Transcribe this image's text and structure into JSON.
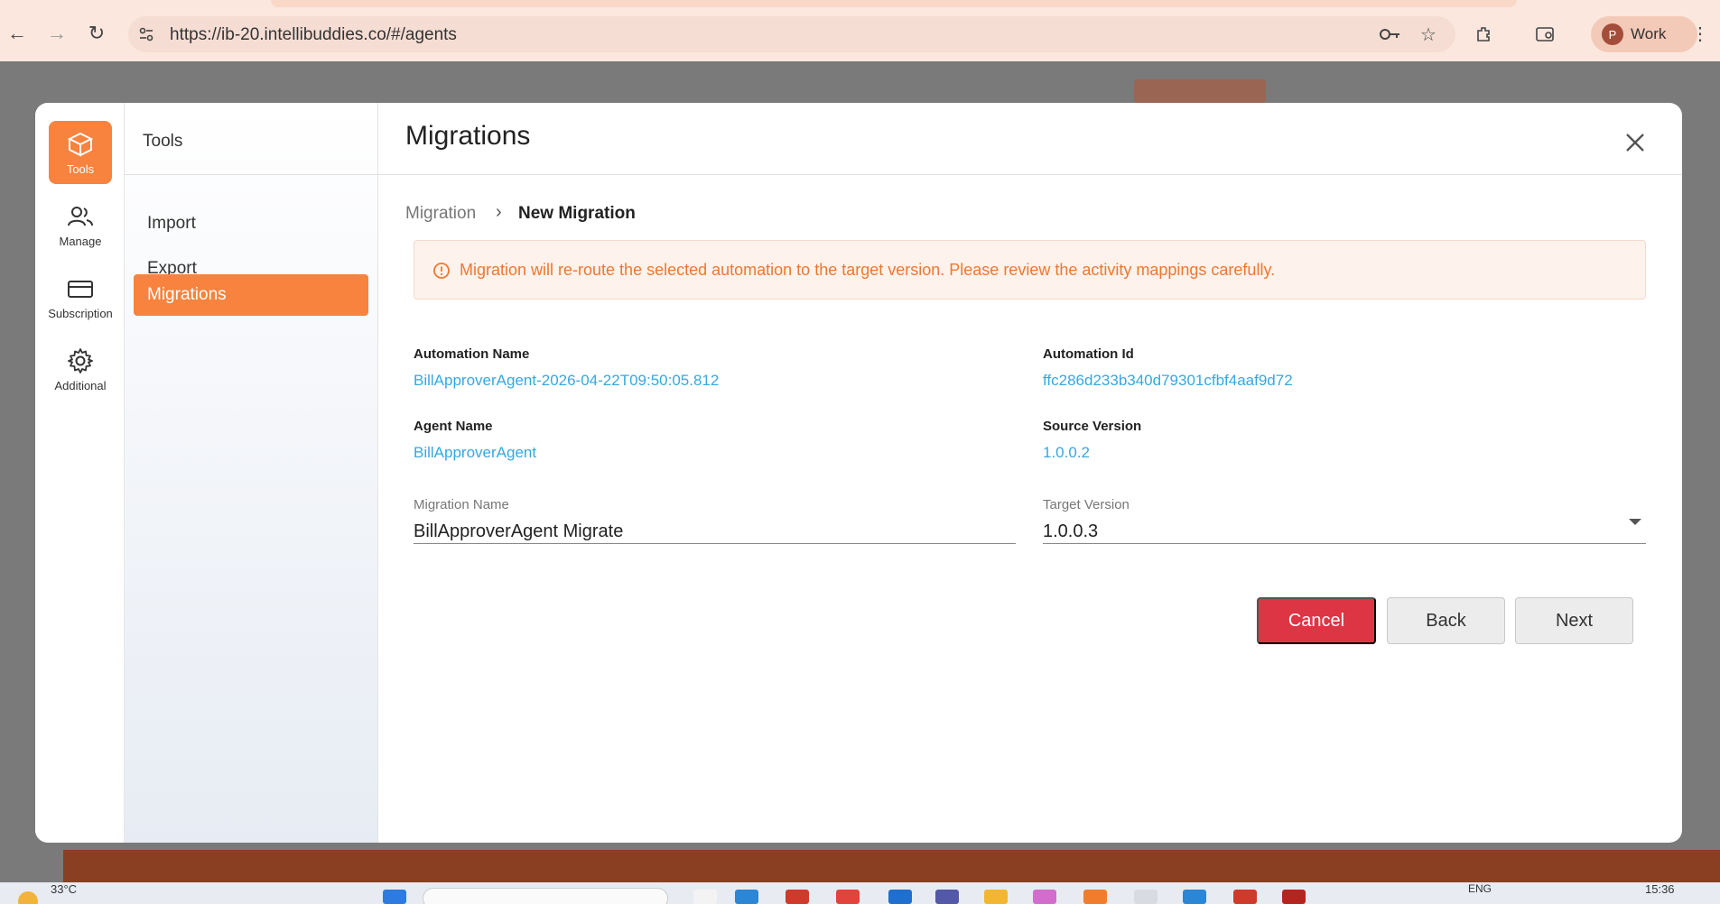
{
  "browser": {
    "url": "https://ib-20.intellibuddies.co/#/agents",
    "profile_initial": "P",
    "profile_label": "Work"
  },
  "rail": {
    "items": [
      {
        "label": "Tools",
        "icon": "box-icon",
        "active": true
      },
      {
        "label": "Manage",
        "icon": "users-icon",
        "active": false
      },
      {
        "label": "Subscription",
        "icon": "card-icon",
        "active": false
      },
      {
        "label": "Additional",
        "icon": "gear-icon",
        "active": false
      }
    ]
  },
  "subnav": {
    "title": "Tools",
    "items": [
      {
        "label": "Import",
        "active": false
      },
      {
        "label": "Export",
        "active": false
      },
      {
        "label": "Migrations",
        "active": true
      }
    ]
  },
  "header": {
    "title": "Migrations"
  },
  "breadcrumb": {
    "parent": "Migration",
    "current": "New Migration"
  },
  "alert": {
    "text": "Migration will re-route the selected automation to the target version. Please review the activity mappings carefully."
  },
  "details": {
    "automation_name_label": "Automation Name",
    "automation_name": "BillApproverAgent-2026-04-22T09:50:05.812",
    "automation_id_label": "Automation Id",
    "automation_id": "ffc286d233b340d79301cfbf4aaf9d72",
    "agent_name_label": "Agent Name",
    "agent_name": "BillApproverAgent",
    "source_version_label": "Source Version",
    "source_version": "1.0.0.2"
  },
  "form": {
    "migration_name_label": "Migration Name",
    "migration_name": "BillApproverAgent Migrate",
    "target_version_label": "Target Version",
    "target_version": "1.0.0.3"
  },
  "actions": {
    "cancel": "Cancel",
    "back": "Back",
    "next": "Next"
  },
  "taskbar": {
    "temperature": "33°C",
    "lang": "ENG",
    "time": "15:36"
  },
  "colors": {
    "accent": "#f7833e",
    "link": "#35a8e0",
    "danger": "#de3545",
    "alert_text": "#f0772e"
  }
}
